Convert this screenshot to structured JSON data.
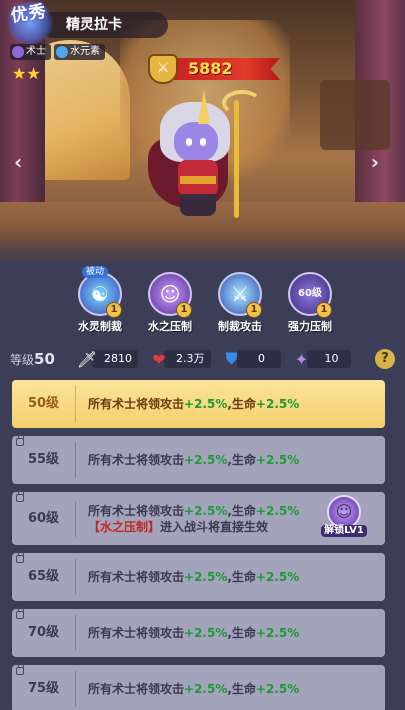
{
  "hero": {
    "quality": "优秀",
    "name": "精灵拉卡",
    "class_tag": "术士",
    "element_tag": "水元素",
    "stars": "★★",
    "power": "5882"
  },
  "nav": {
    "prev": "‹",
    "next": "›"
  },
  "skills": [
    {
      "name": "水灵制裁",
      "level": "1",
      "passive": "被动",
      "icon": "☯"
    },
    {
      "name": "水之压制",
      "level": "1",
      "icon": "☺"
    },
    {
      "name": "制裁攻击",
      "level": "1",
      "icon": "⚔"
    },
    {
      "name": "强力压制",
      "level": "1",
      "icon": "60级"
    }
  ],
  "stats": {
    "level_label": "等级",
    "level_value": "50",
    "attack": "2810",
    "hp": "2.3万",
    "defense": "0",
    "crystal": "10",
    "help": "?"
  },
  "level_rows": [
    {
      "level": "50级",
      "prefix": "所有术士将领攻击",
      "atk": "+2.5%",
      "mid": ",生命",
      "hp": "+2.5%",
      "active": true
    },
    {
      "level": "55级",
      "prefix": "所有术士将领攻击",
      "atk": "+2.5%",
      "mid": ",生命",
      "hp": "+2.5%"
    },
    {
      "level": "60级",
      "prefix": "所有术士将领攻击",
      "atk": "+2.5%",
      "mid": ",生命",
      "hp": "+2.5%",
      "extra_skill": "【水之压制】",
      "extra_text": "进入战斗将直接生效",
      "unlock_label": "解锁LV1"
    },
    {
      "level": "65级",
      "prefix": "所有术士将领攻击",
      "atk": "+2.5%",
      "mid": ",生命",
      "hp": "+2.5%"
    },
    {
      "level": "70级",
      "prefix": "所有术士将领攻击",
      "atk": "+2.5%",
      "mid": ",生命",
      "hp": "+2.5%"
    },
    {
      "level": "75级",
      "prefix": "所有术士将领攻击",
      "atk": "+2.5%",
      "mid": ",生命",
      "hp": "+2.5%"
    }
  ],
  "colors": {
    "active_row": "#f4cf6e",
    "locked_row": "#a3a3bc",
    "bonus_green": "#1e9b36",
    "skill_red": "#c0281f",
    "power_banner": "#c61f1f"
  }
}
